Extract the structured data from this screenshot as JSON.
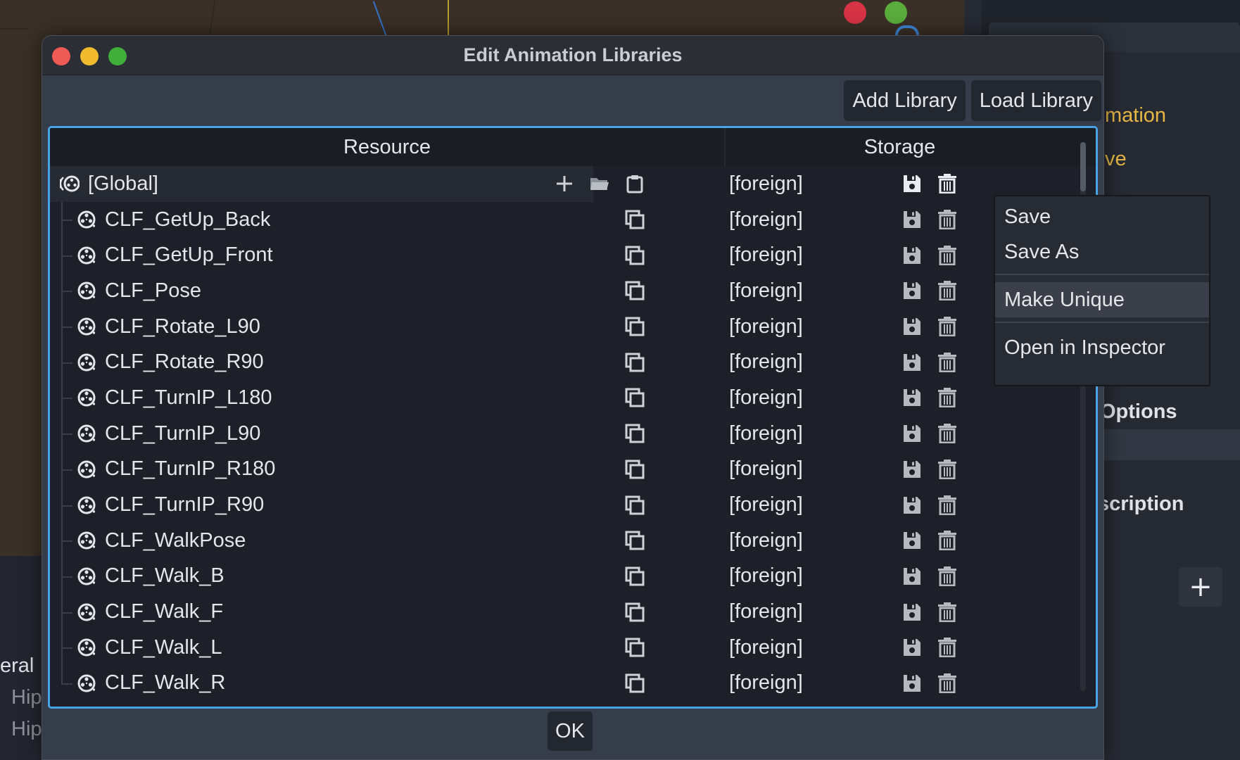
{
  "dialog": {
    "title": "Edit Animation Libraries",
    "add_library": "Add Library",
    "load_library": "Load Library",
    "ok": "OK"
  },
  "table": {
    "headers": {
      "resource": "Resource",
      "storage": "Storage"
    },
    "global": {
      "name": "[Global]",
      "storage": "[foreign]"
    },
    "animations": [
      {
        "name": "CLF_GetUp_Back",
        "storage": "[foreign]"
      },
      {
        "name": "CLF_GetUp_Front",
        "storage": "[foreign]"
      },
      {
        "name": "CLF_Pose",
        "storage": "[foreign]"
      },
      {
        "name": "CLF_Rotate_L90",
        "storage": "[foreign]"
      },
      {
        "name": "CLF_Rotate_R90",
        "storage": "[foreign]"
      },
      {
        "name": "CLF_TurnIP_L180",
        "storage": "[foreign]"
      },
      {
        "name": "CLF_TurnIP_L90",
        "storage": "[foreign]"
      },
      {
        "name": "CLF_TurnIP_R180",
        "storage": "[foreign]"
      },
      {
        "name": "CLF_TurnIP_R90",
        "storage": "[foreign]"
      },
      {
        "name": "CLF_WalkPose",
        "storage": "[foreign]"
      },
      {
        "name": "CLF_Walk_B",
        "storage": "[foreign]"
      },
      {
        "name": "CLF_Walk_F",
        "storage": "[foreign]"
      },
      {
        "name": "CLF_Walk_L",
        "storage": "[foreign]"
      },
      {
        "name": "CLF_Walk_R",
        "storage": "[foreign]"
      }
    ]
  },
  "context_menu": {
    "items": [
      "Save",
      "Save As",
      "Make Unique",
      "Open in Inspector"
    ],
    "highlighted": "Make Unique"
  },
  "background": {
    "right_panel": {
      "mation": "mation",
      "ve": "ve",
      "options": "Options",
      "scription": "scription"
    },
    "left_panel": {
      "eral": "eral",
      "hip1": "Hip",
      "hip2": "Hip"
    }
  },
  "colors": {
    "accent_focus": "#4aa2e6",
    "inspector_accent": "#e7b846",
    "traffic_close": "#ee5b56",
    "traffic_min": "#f2bb2f",
    "traffic_max": "#3fae3a"
  },
  "icons": {
    "animation": "animation-reel-icon",
    "global": "library-icon",
    "add": "plus-icon",
    "load": "folder-icon",
    "paste": "clipboard-icon",
    "copy": "duplicate-icon",
    "save": "floppy-icon",
    "delete": "trash-icon"
  }
}
